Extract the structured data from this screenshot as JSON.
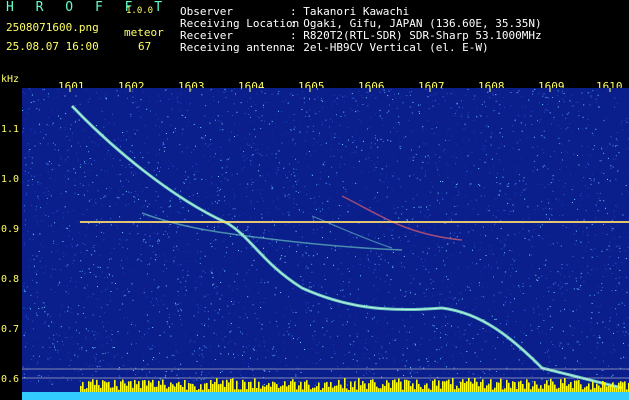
{
  "header": {
    "title": "H R O F F T",
    "version": "1.0.0",
    "filename": "2508071600.png",
    "timestamp": "25.08.07 16:00",
    "meteor_label": "meteor",
    "meteor_count": "67",
    "observer_key": "Observer",
    "observer_value": ": Takanori Kawachi",
    "location_key": "Receiving Location",
    "location_value": ": Ogaki, Gifu, JAPAN (136.60E, 35.35N)",
    "receiver_key": "Receiver",
    "receiver_value": ": R820T2(RTL-SDR) SDR-Sharp 53.1000MHz",
    "antenna_key": "Receiving antenna",
    "antenna_value": ": 2el-HB9CV Vertical (el. E-W)"
  },
  "axes": {
    "y_unit": "kHz",
    "x_ticks": [
      "1601",
      "1602",
      "1603",
      "1604",
      "1605",
      "1606",
      "1607",
      "1608",
      "1609",
      "1610"
    ],
    "y_ticks": [
      "1.1",
      "1.0",
      "0.9",
      "0.8",
      "0.7",
      "0.6"
    ]
  },
  "colors": {
    "label": "#ffff66",
    "title": "#66ffcc",
    "spectrum_bg": "#0a1e8c",
    "carrier": "#ffd24a",
    "activity_bars": "#ffff00",
    "baseline": "#33ccff"
  }
}
